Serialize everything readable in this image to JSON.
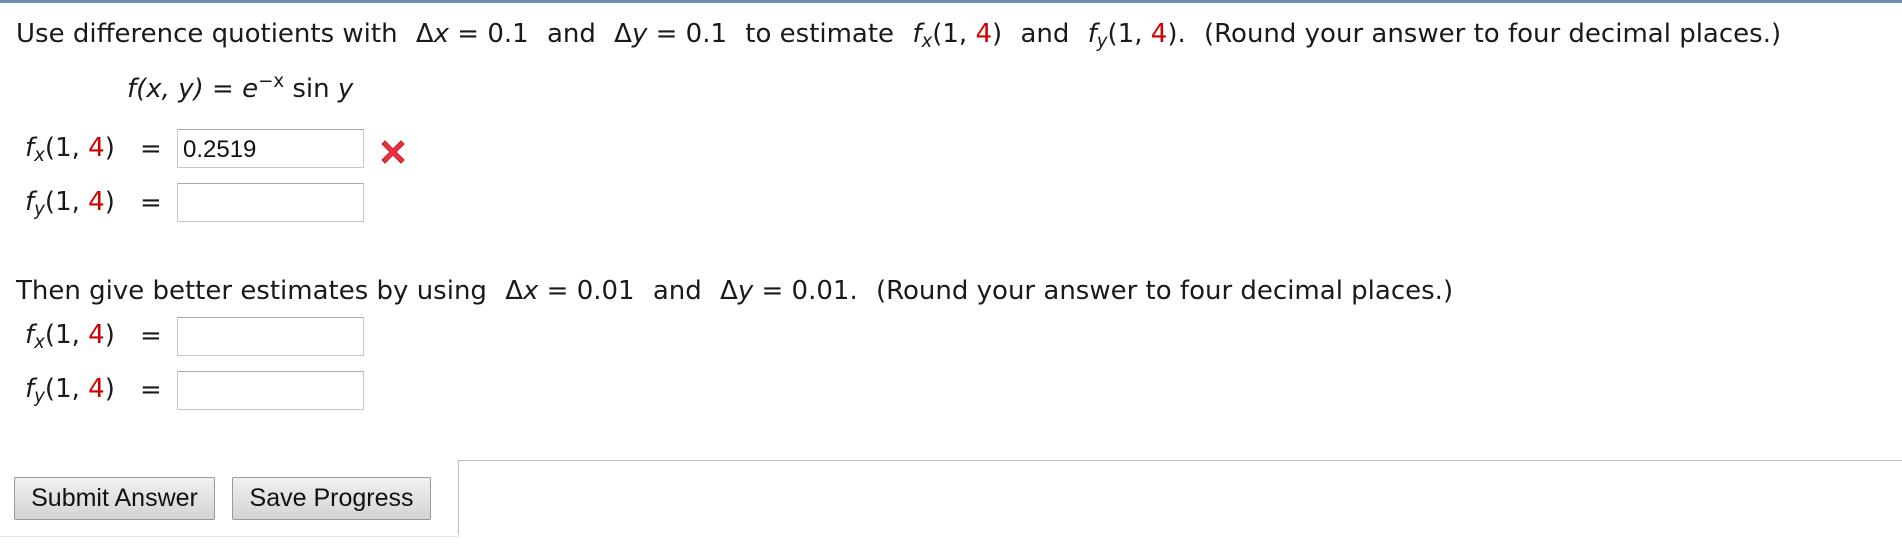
{
  "question": {
    "intro": {
      "lead": "Use difference quotients with",
      "delta_x": "Δ",
      "x_var": "x",
      "eq_x": "= 0.1",
      "and1": "and",
      "delta_y": "Δ",
      "y_var": "y",
      "eq_y": "= 0.1",
      "to_estimate": "to estimate",
      "fx_f": "f",
      "fx_sub": "x",
      "fx_open": "(1,",
      "fx_point": "4",
      "fx_close": ")",
      "and2": "and",
      "fy_f": "f",
      "fy_sub": "y",
      "fy_open": "(1,",
      "fy_point": "4",
      "fy_close": ").",
      "instruction": "(Round your answer to four decimal places.)"
    },
    "formula": {
      "lhs": "f(x, y)",
      "eq": "=",
      "base": "e",
      "exponent": "−x",
      "rhs": "sin",
      "rhs_var": "y"
    },
    "part1": {
      "fx": {
        "f": "f",
        "sub": "x",
        "open": "(1,",
        "point": "4",
        "close": ")",
        "eq": "=",
        "value": "0.2519",
        "status": "incorrect"
      },
      "fy": {
        "f": "f",
        "sub": "y",
        "open": "(1,",
        "point": "4",
        "close": ")",
        "eq": "=",
        "value": ""
      }
    },
    "then": {
      "lead": "Then give better estimates by using",
      "delta_x": "Δ",
      "x_var": "x",
      "eq_x": "= 0.01",
      "and1": "and",
      "delta_y": "Δ",
      "y_var": "y",
      "eq_y": "= 0.01.",
      "instruction": "(Round your answer to four decimal places.)"
    },
    "part2": {
      "fx": {
        "f": "f",
        "sub": "x",
        "open": "(1,",
        "point": "4",
        "close": ")",
        "eq": "=",
        "value": ""
      },
      "fy": {
        "f": "f",
        "sub": "y",
        "open": "(1,",
        "point": "4",
        "close": ")",
        "eq": "=",
        "value": ""
      }
    }
  },
  "buttons": {
    "submit": "Submit Answer",
    "save": "Save Progress"
  },
  "icons": {
    "incorrect": "close-x-icon"
  },
  "colors": {
    "point_highlight": "#cc0000",
    "incorrect_mark": "#e8343f",
    "top_rule": "#6f8db3"
  }
}
